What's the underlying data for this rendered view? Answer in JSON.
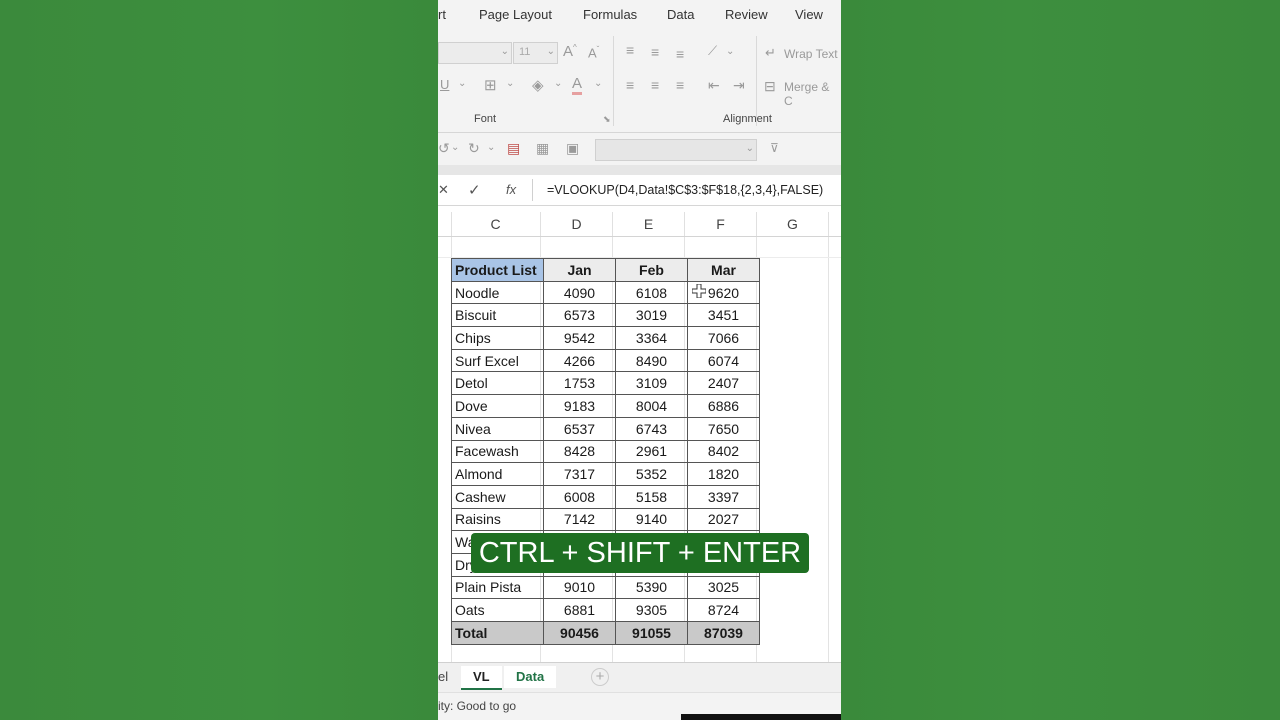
{
  "ribbon": {
    "tabs": [
      "rt",
      "Page Layout",
      "Formulas",
      "Data",
      "Review",
      "View"
    ],
    "font_size": "11",
    "wrap_text": "Wrap Text",
    "merge": "Merge & C",
    "group_font": "Font",
    "group_alignment": "Alignment"
  },
  "formula_bar": {
    "cancel": "✕",
    "enter": "✓",
    "fx": "fx",
    "formula": "=VLOOKUP(D4,Data!$C$3:$F$18,{2,3,4},FALSE)"
  },
  "columns": [
    "C",
    "D",
    "E",
    "F",
    "G"
  ],
  "table": {
    "headers": [
      "Product List",
      "Jan",
      "Feb",
      "Mar"
    ],
    "rows": [
      [
        "Noodle",
        "4090",
        "6108",
        "9620"
      ],
      [
        "Biscuit",
        "6573",
        "3019",
        "3451"
      ],
      [
        "Chips",
        "9542",
        "3364",
        "7066"
      ],
      [
        "Surf Excel",
        "4266",
        "8490",
        "6074"
      ],
      [
        "Detol",
        "1753",
        "3109",
        "2407"
      ],
      [
        "Dove",
        "9183",
        "8004",
        "6886"
      ],
      [
        "Nivea",
        "6537",
        "6743",
        "7650"
      ],
      [
        "Facewash",
        "8428",
        "2961",
        "8402"
      ],
      [
        "Almond",
        "7317",
        "5352",
        "1820"
      ],
      [
        "Cashew",
        "6008",
        "5158",
        "3397"
      ],
      [
        "Raisins",
        "7142",
        "9140",
        "2027"
      ],
      [
        "Wa",
        "",
        "",
        ""
      ],
      [
        "Dry",
        "",
        "",
        ""
      ],
      [
        "Plain Pista",
        "9010",
        "5390",
        "3025"
      ],
      [
        "Oats",
        "6881",
        "9305",
        "8724"
      ]
    ],
    "total": [
      "Total",
      "90456",
      "91055",
      "87039"
    ]
  },
  "overlay_text": "CTRL + SHIFT + ENTER",
  "sheet_tabs": {
    "partial": "el",
    "vl": "VL",
    "data": "Data",
    "add": "+"
  },
  "status": "ity: Good to go",
  "colors": {
    "background": "#3a8c3c",
    "overlay": "#1e6f22",
    "header_blue": "#a9c4e6",
    "total_gray": "#c9c9c9",
    "sheet_tab_green": "#217346"
  }
}
